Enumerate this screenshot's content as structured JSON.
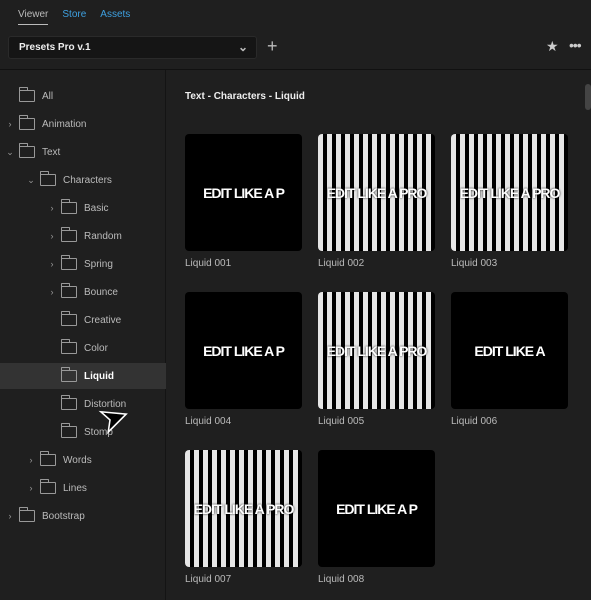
{
  "tabs": [
    "Viewer",
    "Store",
    "Assets"
  ],
  "preset": {
    "value": "Presets Pro v.1"
  },
  "icons": {
    "add": "+",
    "favorite": "★",
    "more": "•••",
    "dropdown": "⌄"
  },
  "sidebar": [
    {
      "label": "All",
      "depth": 0,
      "arrow": ""
    },
    {
      "label": "Animation",
      "depth": 0,
      "arrow": "›"
    },
    {
      "label": "Text",
      "depth": 0,
      "arrow": "⌄"
    },
    {
      "label": "Characters",
      "depth": 1,
      "arrow": "⌄"
    },
    {
      "label": "Basic",
      "depth": 2,
      "arrow": "›"
    },
    {
      "label": "Random",
      "depth": 2,
      "arrow": "›"
    },
    {
      "label": "Spring",
      "depth": 2,
      "arrow": "›"
    },
    {
      "label": "Bounce",
      "depth": 2,
      "arrow": "›"
    },
    {
      "label": "Creative",
      "depth": 2,
      "arrow": ""
    },
    {
      "label": "Color",
      "depth": 2,
      "arrow": ""
    },
    {
      "label": "Liquid",
      "depth": 2,
      "arrow": "",
      "selected": true
    },
    {
      "label": "Distortion",
      "depth": 2,
      "arrow": ""
    },
    {
      "label": "Stomp",
      "depth": 2,
      "arrow": ""
    },
    {
      "label": "Words",
      "depth": 1,
      "arrow": "›"
    },
    {
      "label": "Lines",
      "depth": 1,
      "arrow": "›"
    },
    {
      "label": "Bootstrap",
      "depth": 0,
      "arrow": "›"
    }
  ],
  "main": {
    "breadcrumb": "Text - Characters - Liquid",
    "items": [
      {
        "name": "Liquid 001",
        "preview": "EDIT LIKE A P"
      },
      {
        "name": "Liquid 002",
        "preview": "EDIT LIKE A PRO"
      },
      {
        "name": "Liquid 003",
        "preview": "EDIT LIKE A PRO"
      },
      {
        "name": "Liquid 004",
        "preview": "EDIT LIKE A P"
      },
      {
        "name": "Liquid 005",
        "preview": "EDIT LIKE A PRO"
      },
      {
        "name": "Liquid 006",
        "preview": "EDIT LIKE A"
      },
      {
        "name": "Liquid 007",
        "preview": "EDIT LIKE A PRO"
      },
      {
        "name": "Liquid 008",
        "preview": "EDIT LIKE A P"
      }
    ]
  }
}
